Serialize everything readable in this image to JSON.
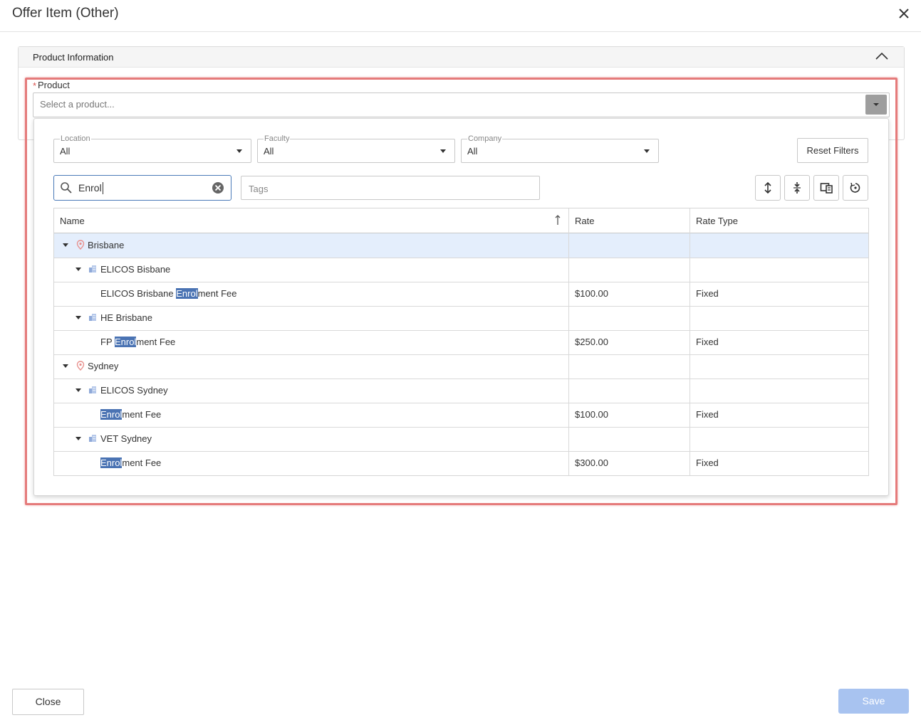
{
  "dialog": {
    "title": "Offer Item (Other)"
  },
  "section": {
    "title": "Product Information"
  },
  "product": {
    "required_mark": "*",
    "label": "Product",
    "placeholder": "Select a product..."
  },
  "filters": {
    "location": {
      "label": "Location",
      "value": "All"
    },
    "faculty": {
      "label": "Faculty",
      "value": "All"
    },
    "company": {
      "label": "Company",
      "value": "All"
    },
    "reset_label": "Reset Filters"
  },
  "search": {
    "value": "Enrol"
  },
  "tags": {
    "placeholder": "Tags"
  },
  "toolbar_icons": [
    "expand-all-icon",
    "collapse-all-icon",
    "columns-icon",
    "refresh-icon"
  ],
  "grid": {
    "columns": {
      "name": "Name",
      "rate": "Rate",
      "rate_type": "Rate Type"
    },
    "rows": [
      {
        "type": "location",
        "name": "Brisbane",
        "rate": "",
        "rate_type": "",
        "selected": true
      },
      {
        "type": "company",
        "name": "ELICOS Bisbane",
        "rate": "",
        "rate_type": ""
      },
      {
        "type": "product",
        "name_before": "ELICOS Brisbane ",
        "name_match": "Enrol",
        "name_after": "ment Fee",
        "rate": "$100.00",
        "rate_type": "Fixed"
      },
      {
        "type": "company",
        "name": "HE Brisbane",
        "rate": "",
        "rate_type": ""
      },
      {
        "type": "product",
        "name_before": "FP ",
        "name_match": "Enrol",
        "name_after": "ment Fee",
        "rate": "$250.00",
        "rate_type": "Fixed"
      },
      {
        "type": "location",
        "name": "Sydney",
        "rate": "",
        "rate_type": ""
      },
      {
        "type": "company",
        "name": "ELICOS Sydney",
        "rate": "",
        "rate_type": ""
      },
      {
        "type": "product",
        "name_before": "",
        "name_match": "Enrol",
        "name_after": "ment Fee",
        "rate": "$100.00",
        "rate_type": "Fixed"
      },
      {
        "type": "company",
        "name": "VET Sydney",
        "rate": "",
        "rate_type": ""
      },
      {
        "type": "product",
        "name_before": "",
        "name_match": "Enrol",
        "name_after": "ment Fee",
        "rate": "$300.00",
        "rate_type": "Fixed"
      }
    ]
  },
  "footer": {
    "close_label": "Close",
    "save_label": "Save"
  },
  "colors": {
    "highlight_border": "#e57b7b",
    "selection": "#e4eefc",
    "match": "#4a73b3",
    "save_disabled": "#a8c3f0",
    "location_pin": "#e8908d",
    "building": "#8fa9d8"
  }
}
